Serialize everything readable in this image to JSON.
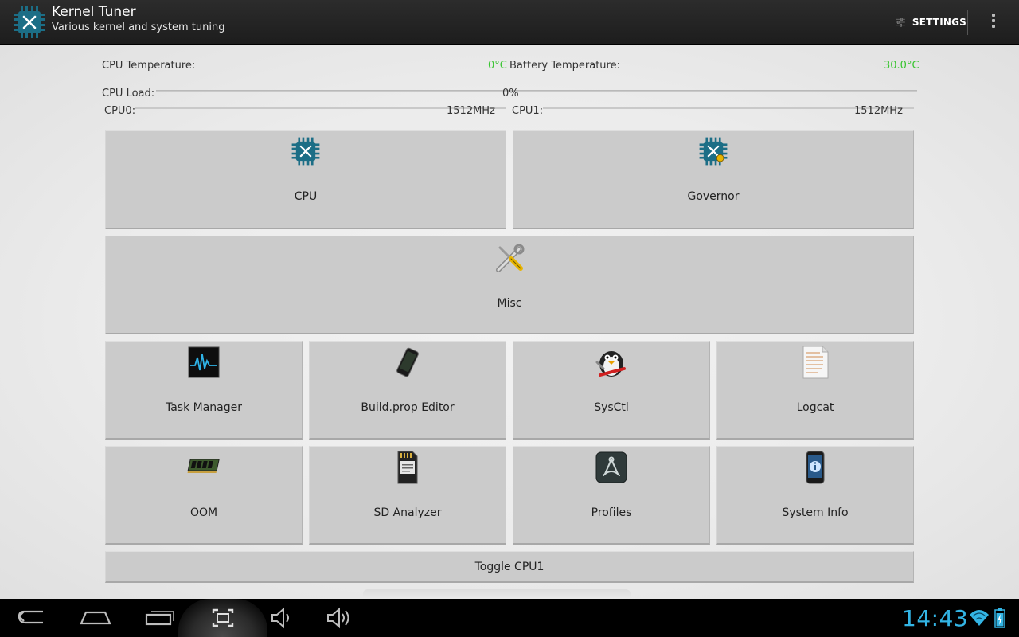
{
  "app": {
    "title": "Kernel Tuner",
    "subtitle": "Various kernel and system tuning",
    "settings_label": "SETTINGS"
  },
  "stats": {
    "cpu_temp_label": "CPU Temperature:",
    "cpu_temp_value": "0°C",
    "battery_temp_label": "Battery Temperature:",
    "battery_temp_value": "30.0°C",
    "cpu_load_label": "CPU Load:",
    "cpu_load_value": "0%",
    "cpu0_label": "CPU0:",
    "cpu0_value": "1512MHz",
    "cpu1_label": "CPU1:",
    "cpu1_value": "1512MHz"
  },
  "tiles": {
    "cpu": "CPU",
    "governor": "Governor",
    "misc": "Misc",
    "task_manager": "Task Manager",
    "buildprop_editor": "Build.prop Editor",
    "sysctl": "SysCtl",
    "logcat": "Logcat",
    "oom": "OOM",
    "sd_analyzer": "SD Analyzer",
    "profiles": "Profiles",
    "system_info": "System Info",
    "toggle_cpu1": "Toggle CPU1"
  },
  "status_bar": {
    "clock": "14:43"
  },
  "colors": {
    "accent_green": "#39c531",
    "clock_blue": "#33b5e5",
    "chip_teal": "#1c6e86"
  },
  "icons": {
    "app": "kernel-chip-icon",
    "settings": "sliders-icon",
    "overflow": "overflow-menu-icon",
    "nav": [
      "back-icon",
      "home-icon",
      "recent-apps-icon",
      "screenshot-icon",
      "volume-down-icon",
      "volume-up-icon"
    ],
    "status": [
      "wifi-icon",
      "battery-icon"
    ]
  }
}
